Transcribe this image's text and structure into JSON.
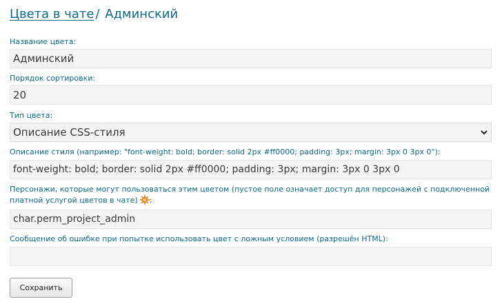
{
  "breadcrumb": {
    "parent_link": "Цвета в чате",
    "separator": "/",
    "current": "Админский"
  },
  "form": {
    "name": {
      "label": "Название цвета:",
      "value": "Админский"
    },
    "sort": {
      "label": "Порядок сортировки:",
      "value": "20"
    },
    "type": {
      "label": "Тип цвета:",
      "selected": "Описание CSS-стиля"
    },
    "style": {
      "label": "Описание стиля (например: \"font-weight: bold; border: solid 2px #ff0000; padding: 3px; margin: 3px 0 3px 0\"):",
      "value": "font-weight: bold; border: solid 2px #ff0000; padding: 3px; margin: 3px 0 3px 0"
    },
    "characters": {
      "label_line1": "Персонажи, которые могут пользоваться этим цветом (пустое поле означает доступ для персонажей с подключенной",
      "label_line2": "платной услугой цветов в чате)",
      "label_suffix": ":",
      "value": "char.perm_project_admin"
    },
    "error_message": {
      "label": "Сообщение об ошибке при попытке использовать цвет с ложным условием (разрешён HTML):",
      "value": ""
    },
    "save_label": "Сохранить"
  },
  "icons": {
    "help": "gear-icon",
    "select_arrow": "chevron-down-icon"
  },
  "colors": {
    "accent": "#0b6c8c",
    "gear": "#f08a1c"
  }
}
